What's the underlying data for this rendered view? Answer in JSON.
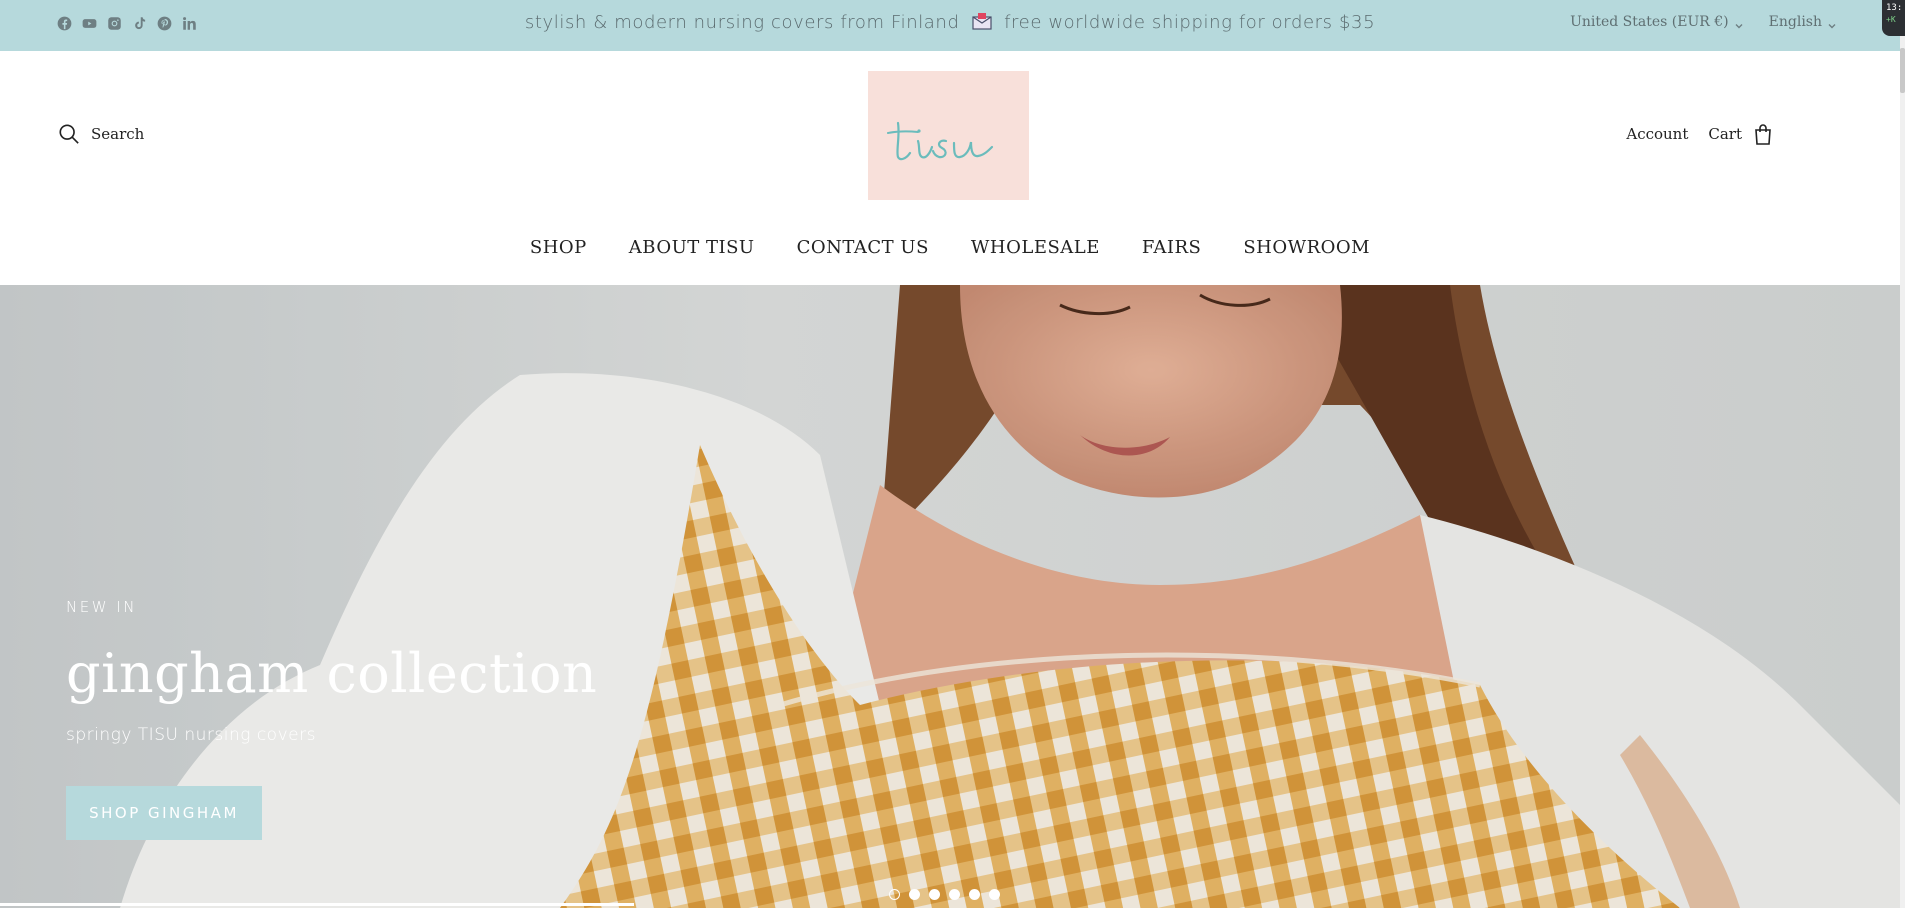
{
  "announcement": {
    "text_before": "stylish & modern nursing covers from Finland",
    "text_after": "free worldwide shipping for orders $35",
    "mail_icon": "envelope-icon",
    "bg_color": "#b6d9dc"
  },
  "socials": [
    {
      "name": "facebook-icon"
    },
    {
      "name": "youtube-icon"
    },
    {
      "name": "instagram-icon"
    },
    {
      "name": "tiktok-icon"
    },
    {
      "name": "pinterest-icon"
    },
    {
      "name": "linkedin-icon"
    }
  ],
  "locale": {
    "country": "United States (EUR €)",
    "language": "English"
  },
  "header": {
    "search_label": "Search",
    "logo_text": "tisu",
    "logo_bg": "#f8e0da",
    "logo_color": "#6bbcbc",
    "account_label": "Account",
    "cart_label": "Cart"
  },
  "nav": {
    "items": [
      {
        "label": "SHOP"
      },
      {
        "label": "ABOUT TISU"
      },
      {
        "label": "CONTACT US"
      },
      {
        "label": "WHOLESALE"
      },
      {
        "label": "FAIRS"
      },
      {
        "label": "SHOWROOM"
      }
    ]
  },
  "hero": {
    "eyebrow": "NEW IN",
    "title": "gingham collection",
    "subtitle": "springy TISU nursing covers",
    "button_label": "SHOP GINGHAM",
    "slide_count": 6,
    "active_slide": 1
  },
  "system": {
    "clock": "13:",
    "clock_sub": "+K"
  }
}
